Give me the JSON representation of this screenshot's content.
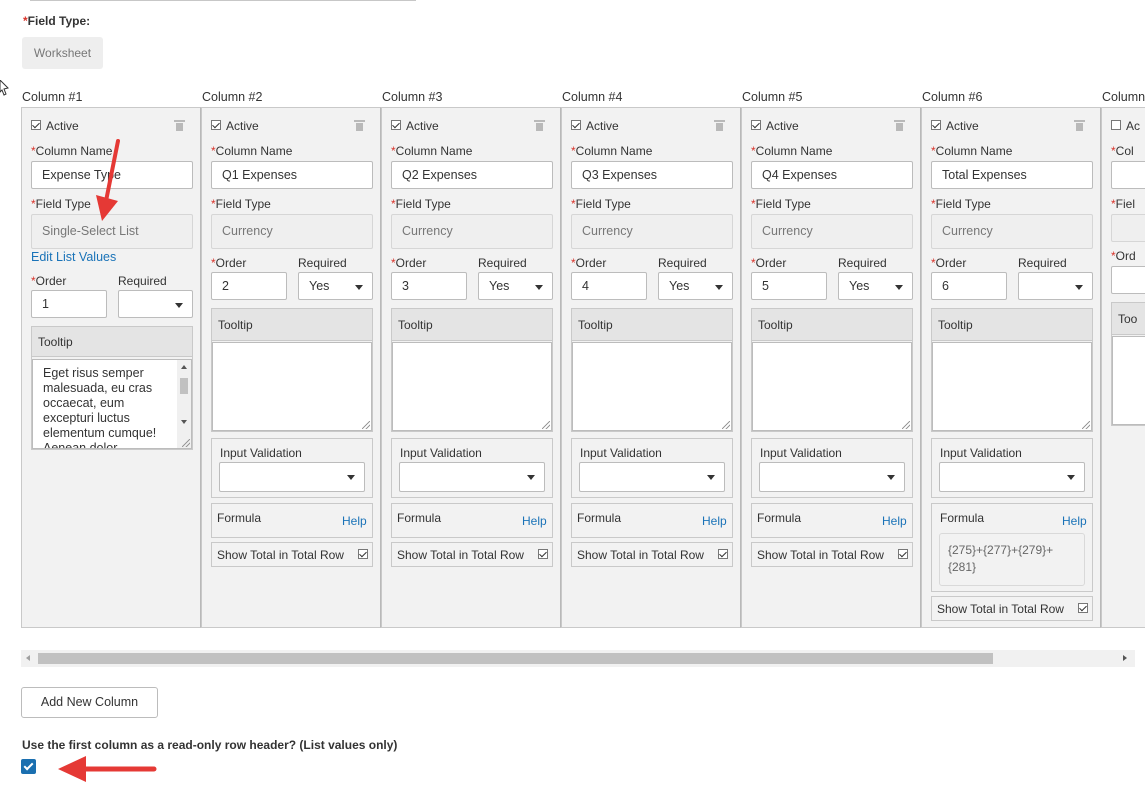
{
  "header": {
    "field_type_label": "Field Type:",
    "field_type_value": "Worksheet"
  },
  "columns": [
    {
      "header": "Column #1",
      "active_label": "Active",
      "column_name_label": "Column Name",
      "column_name_value": "Expense Type",
      "field_type_label": "Field Type",
      "field_type_value": "Single-Select List",
      "edit_list_values": "Edit List Values",
      "order_label": "Order",
      "order_value": "1",
      "required_label": "Required",
      "required_value": "",
      "tooltip_label": "Tooltip",
      "tooltip_text": "Eget risus semper malesuada, eu cras occaecat, eum excepturi luctus elementum cumque! Aenean dolor curabitur?"
    },
    {
      "header": "Column #2",
      "active_label": "Active",
      "column_name_label": "Column Name",
      "column_name_value": "Q1 Expenses",
      "field_type_label": "Field Type",
      "field_type_value": "Currency",
      "order_label": "Order",
      "order_value": "2",
      "required_label": "Required",
      "required_value": "Yes",
      "tooltip_label": "Tooltip",
      "input_validation_label": "Input Validation",
      "formula_label": "Formula",
      "help_label": "Help",
      "show_total_label": "Show Total in Total Row"
    },
    {
      "header": "Column #3",
      "active_label": "Active",
      "column_name_label": "Column Name",
      "column_name_value": "Q2 Expenses",
      "field_type_label": "Field Type",
      "field_type_value": "Currency",
      "order_label": "Order",
      "order_value": "3",
      "required_label": "Required",
      "required_value": "Yes",
      "tooltip_label": "Tooltip",
      "input_validation_label": "Input Validation",
      "formula_label": "Formula",
      "help_label": "Help",
      "show_total_label": "Show Total in Total Row"
    },
    {
      "header": "Column #4",
      "active_label": "Active",
      "column_name_label": "Column Name",
      "column_name_value": "Q3 Expenses",
      "field_type_label": "Field Type",
      "field_type_value": "Currency",
      "order_label": "Order",
      "order_value": "4",
      "required_label": "Required",
      "required_value": "Yes",
      "tooltip_label": "Tooltip",
      "input_validation_label": "Input Validation",
      "formula_label": "Formula",
      "help_label": "Help",
      "show_total_label": "Show Total in Total Row"
    },
    {
      "header": "Column #5",
      "active_label": "Active",
      "column_name_label": "Column Name",
      "column_name_value": "Q4 Expenses",
      "field_type_label": "Field Type",
      "field_type_value": "Currency",
      "order_label": "Order",
      "order_value": "5",
      "required_label": "Required",
      "required_value": "Yes",
      "tooltip_label": "Tooltip",
      "input_validation_label": "Input Validation",
      "formula_label": "Formula",
      "help_label": "Help",
      "show_total_label": "Show Total in Total Row"
    },
    {
      "header": "Column #6",
      "active_label": "Active",
      "column_name_label": "Column Name",
      "column_name_value": "Total Expenses",
      "field_type_label": "Field Type",
      "field_type_value": "Currency",
      "order_label": "Order",
      "order_value": "6",
      "required_label": "Required",
      "required_value": "",
      "tooltip_label": "Tooltip",
      "input_validation_label": "Input Validation",
      "formula_label": "Formula",
      "help_label": "Help",
      "formula_value": "{275}+{277}+{279}+{281}",
      "show_total_label": "Show Total in Total Row"
    },
    {
      "header": "Column",
      "active_label": "Ac",
      "column_name_label": "Col",
      "field_type_label": "Fiel",
      "order_label": "Ord",
      "tooltip_label": "Too"
    }
  ],
  "footer": {
    "add_new_column": "Add New Column",
    "readonly_header_label": "Use the first column as a read-only row header? (List values only)"
  },
  "colors": {
    "accent": "#1a6fb0",
    "required": "#d9342b",
    "annotation_arrow": "#e53935",
    "link": "#1a73b8"
  }
}
